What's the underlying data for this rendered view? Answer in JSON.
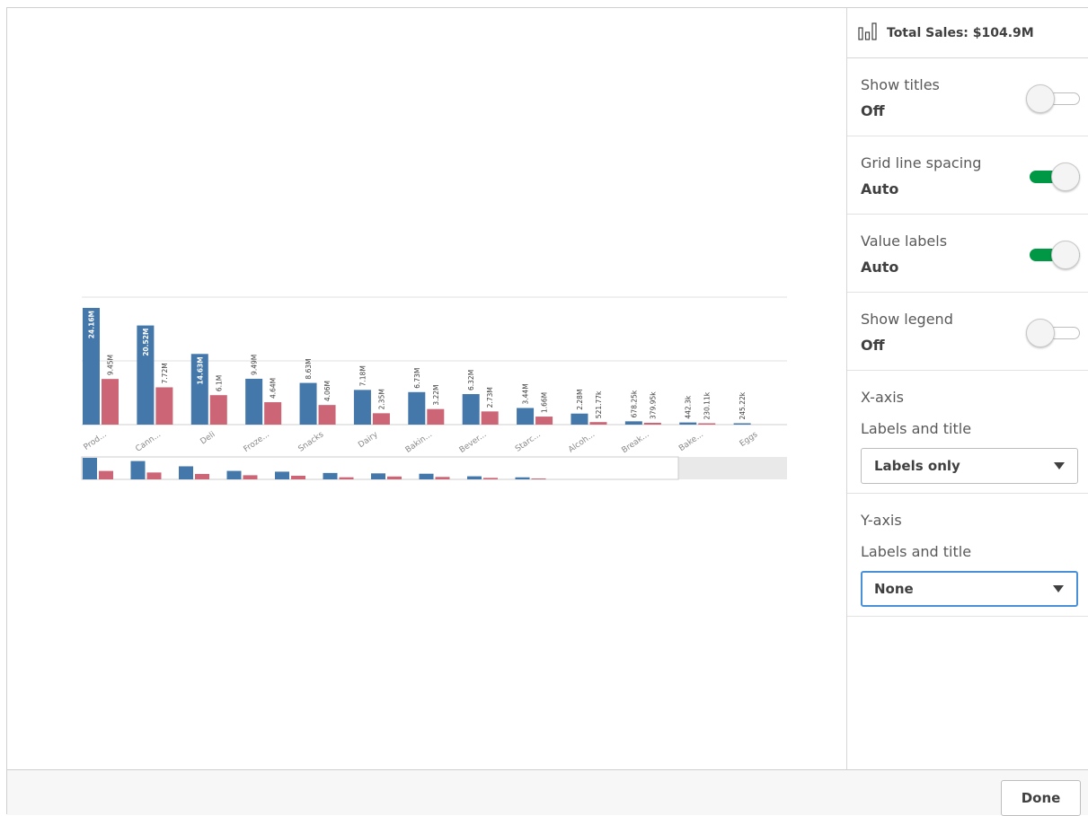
{
  "panel": {
    "header_title": "Total Sales: $104.9M",
    "header_icon": "bar-chart-icon",
    "settings": [
      {
        "label": "Show titles",
        "value": "Off",
        "toggle": false
      },
      {
        "label": "Grid line spacing",
        "value": "Auto",
        "toggle": true
      },
      {
        "label": "Value labels",
        "value": "Auto",
        "toggle": true
      },
      {
        "label": "Show legend",
        "value": "Off",
        "toggle": false
      }
    ],
    "x_axis": {
      "title": "X-axis",
      "sub_label": "Labels and title",
      "selected": "Labels only"
    },
    "y_axis": {
      "title": "Y-axis",
      "sub_label": "Labels and title",
      "selected": "None"
    }
  },
  "footer": {
    "done_label": "Done"
  },
  "colors": {
    "series1": "#4477aa",
    "series2": "#cc6677",
    "toggle_on": "#009845",
    "focus": "#4a90d9"
  },
  "chart_data": {
    "type": "bar",
    "categories": [
      "Prod...",
      "Cann...",
      "Deli",
      "Froze...",
      "Snacks",
      "Dairy",
      "Bakin...",
      "Bever...",
      "Starc...",
      "Alcoh...",
      "Break...",
      "Bake...",
      "Eggs"
    ],
    "series": [
      {
        "values": [
          24.16,
          20.52,
          14.63,
          9.49,
          8.63,
          7.18,
          6.73,
          6.32,
          3.44,
          2.28,
          0.678,
          0.442,
          0.245
        ],
        "labels": [
          "24.16M",
          "20.52M",
          "14.63M",
          "9.49M",
          "8.63M",
          "7.18M",
          "6.73M",
          "6.32M",
          "3.44M",
          "2.28M",
          "678.25k",
          "442.3k",
          "245.22k"
        ]
      },
      {
        "values": [
          9.45,
          7.72,
          6.1,
          4.64,
          4.06,
          2.35,
          3.22,
          2.73,
          1.66,
          0.522,
          0.378,
          0.23,
          0
        ],
        "labels": [
          "9.45M",
          "7.72M",
          "6.1M",
          "4.64M",
          "4.06M",
          "2.35M",
          "3.22M",
          "2.73M",
          "1.66M",
          "521.77k",
          "379.95k",
          "230.11k",
          ""
        ]
      }
    ],
    "ylim": [
      0,
      24.16
    ],
    "grid": true,
    "legend": "none",
    "title": "",
    "xlabel": "",
    "ylabel": "",
    "minichart_values": [
      [
        24.16,
        9.45
      ],
      [
        20.52,
        7.72
      ],
      [
        14.63,
        6.1
      ],
      [
        9.49,
        4.64
      ],
      [
        8.63,
        4.06
      ],
      [
        7.18,
        2.35
      ],
      [
        6.73,
        3.22
      ],
      [
        6.32,
        2.73
      ],
      [
        3.44,
        1.66
      ],
      [
        2.28,
        0.522
      ]
    ]
  }
}
